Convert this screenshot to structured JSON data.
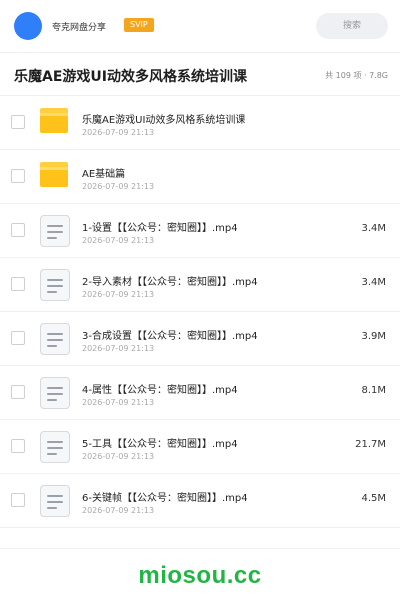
{
  "header": {
    "owner": "夸克网盘分享",
    "badge": "SVIP",
    "search_placeholder": "搜索"
  },
  "share": {
    "title": "乐魔AE游戏UI动效多风格系统培训课",
    "summary": "共 109 项 · 7.8G"
  },
  "items": [
    {
      "type": "folder",
      "name": "乐魔AE游戏UI动效多风格系统培训课",
      "date": "2026-07-09 21:13",
      "size": ""
    },
    {
      "type": "folder",
      "name": "AE基础篇",
      "date": "2026-07-09 21:13",
      "size": ""
    },
    {
      "type": "file",
      "name": "1-设置【【公众号：密知圈】】.mp4",
      "date": "2026-07-09 21:13",
      "size": "3.4M"
    },
    {
      "type": "file",
      "name": "2-导入素材【【公众号：密知圈】】.mp4",
      "date": "2026-07-09 21:13",
      "size": "3.4M"
    },
    {
      "type": "file",
      "name": "3-合成设置【【公众号：密知圈】】.mp4",
      "date": "2026-07-09 21:13",
      "size": "3.9M"
    },
    {
      "type": "file",
      "name": "4-属性【【公众号：密知圈】】.mp4",
      "date": "2026-07-09 21:13",
      "size": "8.1M"
    },
    {
      "type": "file",
      "name": "5-工具【【公众号：密知圈】】.mp4",
      "date": "2026-07-09 21:13",
      "size": "21.7M"
    },
    {
      "type": "file",
      "name": "6-关键帧【【公众号：密知圈】】.mp4",
      "date": "2026-07-09 21:13",
      "size": "4.5M"
    }
  ],
  "watermark": "miosou.cc",
  "colors": {
    "avatar": "#2f80f8",
    "badge": "#f4a51f",
    "folder": "#ffc21a",
    "watermark": "#23b544"
  }
}
